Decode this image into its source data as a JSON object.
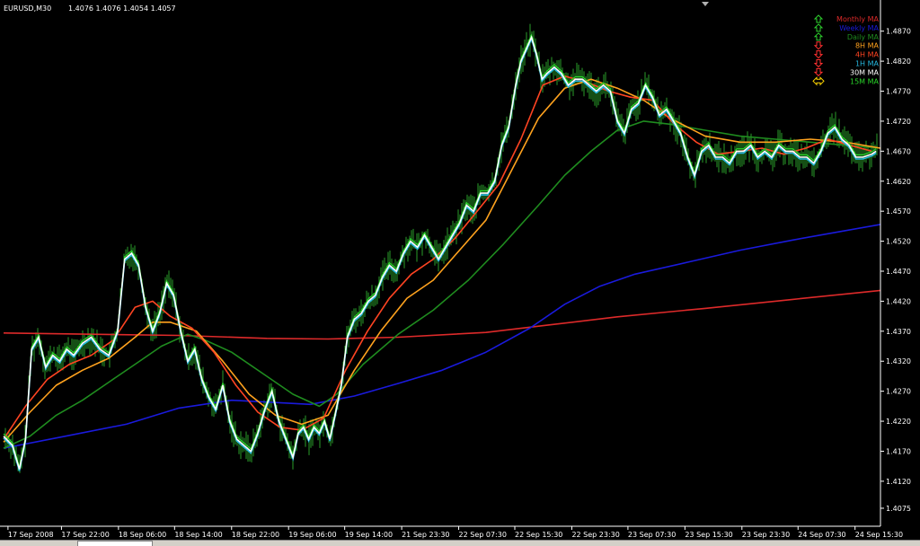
{
  "header": {
    "symbol": "EURUSD,M30",
    "ohlc": "1.4076 1.4076 1.4054 1.4057"
  },
  "colors": {
    "background": "#000000",
    "axis": "#ffffff",
    "bull_bar": "#2a9e2a",
    "price": "#ffffff",
    "monthly": "#dd2a2a",
    "weekly": "#1a1adc",
    "daily": "#1f8c1f",
    "ma8h": "#ffa21e",
    "ma4h": "#ff4422",
    "ma1h": "#26b8e0",
    "ma30m": "#ffffff",
    "ma15m": "#29d629",
    "arrow_up": "#2ed12e",
    "arrow_down": "#ff3030",
    "arrow_side": "#ffd700"
  },
  "legend": [
    {
      "label": "Monthly MA",
      "color": "#dd2a2a",
      "arrow": "up",
      "arrow_color": "#2ed12e"
    },
    {
      "label": "Weekly MA",
      "color": "#1a1adc",
      "arrow": "up",
      "arrow_color": "#2ed12e"
    },
    {
      "label": "Daily MA",
      "color": "#1f8c1f",
      "arrow": "up",
      "arrow_color": "#2ed12e"
    },
    {
      "label": "8H MA",
      "color": "#ffa21e",
      "arrow": "down",
      "arrow_color": "#ff3030"
    },
    {
      "label": "4H MA",
      "color": "#ff4422",
      "arrow": "down",
      "arrow_color": "#ff3030"
    },
    {
      "label": "1H MA",
      "color": "#26b8e0",
      "arrow": "down",
      "arrow_color": "#ff3030"
    },
    {
      "label": "30M MA",
      "color": "#ffffff",
      "arrow": "down",
      "arrow_color": "#ff3030"
    },
    {
      "label": "15M MA",
      "color": "#29d629",
      "arrow": "side",
      "arrow_color": "#ffd700"
    }
  ],
  "chart_data": {
    "type": "line",
    "ylim": [
      1.4045,
      1.4895
    ],
    "xlim": [
      0,
      100
    ],
    "y_ticks": [
      "1.4870",
      "1.4820",
      "1.4770",
      "1.4720",
      "1.4670",
      "1.4620",
      "1.4570",
      "1.4520",
      "1.4470",
      "1.4420",
      "1.4370",
      "1.4320",
      "1.4270",
      "1.4220",
      "1.4170",
      "1.4120",
      "1.4075"
    ],
    "x_ticks": [
      {
        "label": "17 Sep 2008",
        "x": 0.5
      },
      {
        "label": "17 Sep 22:00",
        "x": 6.6
      },
      {
        "label": "18 Sep 06:00",
        "x": 13.1
      },
      {
        "label": "18 Sep 14:00",
        "x": 19.5
      },
      {
        "label": "18 Sep 22:00",
        "x": 26
      },
      {
        "label": "19 Sep 06:00",
        "x": 32.5
      },
      {
        "label": "19 Sep 14:00",
        "x": 38.9
      },
      {
        "label": "21 Sep 23:30",
        "x": 45.4
      },
      {
        "label": "22 Sep 07:30",
        "x": 51.9
      },
      {
        "label": "22 Sep 15:30",
        "x": 58.3
      },
      {
        "label": "22 Sep 23:30",
        "x": 64.8
      },
      {
        "label": "23 Sep 07:30",
        "x": 71.2
      },
      {
        "label": "23 Sep 15:30",
        "x": 77.7
      },
      {
        "label": "23 Sep 23:30",
        "x": 84.2
      },
      {
        "label": "24 Sep 07:30",
        "x": 90.6
      },
      {
        "label": "24 Sep 15:30",
        "x": 97.1
      }
    ],
    "price_x": [
      0,
      1,
      1.8,
      2.5,
      3.2,
      4,
      4.8,
      5.6,
      6.4,
      7.2,
      8,
      9,
      10,
      11,
      12,
      13,
      13.8,
      14.6,
      15.4,
      16.2,
      17,
      17.8,
      18.6,
      19.4,
      20.2,
      21,
      21.8,
      22.6,
      23.4,
      24.2,
      25,
      25.8,
      26.6,
      27.4,
      28.2,
      29,
      29.8,
      30.6,
      31.4,
      32.2,
      33,
      33.6,
      34.2,
      34.8,
      35.4,
      36,
      36.6,
      37.2,
      37.8,
      38.5,
      39.2,
      40,
      40.8,
      41.6,
      42.4,
      43.2,
      44,
      44.8,
      45.6,
      46.4,
      47.2,
      48,
      48.8,
      49.6,
      50.4,
      51.2,
      52,
      52.8,
      53.6,
      54.4,
      55.2,
      56,
      56.8,
      57.6,
      58.4,
      59,
      59.6,
      60.2,
      60.8,
      61.4,
      62,
      62.8,
      63.6,
      64.4,
      65.2,
      66,
      66.8,
      67.6,
      68.4,
      69.2,
      70,
      70.8,
      71.6,
      72.4,
      73.2,
      74,
      74.8,
      75.6,
      76.4,
      77.2,
      78,
      78.8,
      79.6,
      80.4,
      81.2,
      82,
      82.8,
      83.6,
      84.4,
      85.2,
      86,
      86.8,
      87.6,
      88.4,
      89.2,
      90,
      90.8,
      91.6,
      92.4,
      93.2,
      94,
      94.8,
      95.6,
      96.4,
      97.2,
      98,
      99,
      99.5
    ],
    "price_y": [
      1.4195,
      1.418,
      1.414,
      1.419,
      1.434,
      1.436,
      1.431,
      1.433,
      1.432,
      1.434,
      1.433,
      1.435,
      1.436,
      1.434,
      1.433,
      1.437,
      1.449,
      1.45,
      1.448,
      1.441,
      1.437,
      1.44,
      1.445,
      1.443,
      1.437,
      1.432,
      1.434,
      1.429,
      1.426,
      1.424,
      1.428,
      1.422,
      1.419,
      1.418,
      1.417,
      1.42,
      1.424,
      1.427,
      1.422,
      1.419,
      1.416,
      1.42,
      1.421,
      1.419,
      1.421,
      1.42,
      1.422,
      1.419,
      1.423,
      1.428,
      1.436,
      1.439,
      1.44,
      1.442,
      1.443,
      1.446,
      1.448,
      1.447,
      1.45,
      1.452,
      1.451,
      1.453,
      1.451,
      1.449,
      1.451,
      1.453,
      1.455,
      1.458,
      1.457,
      1.46,
      1.46,
      1.462,
      1.468,
      1.471,
      1.478,
      1.482,
      1.484,
      1.486,
      1.483,
      1.479,
      1.48,
      1.481,
      1.48,
      1.478,
      1.479,
      1.479,
      1.478,
      1.477,
      1.478,
      1.477,
      1.472,
      1.47,
      1.474,
      1.475,
      1.478,
      1.476,
      1.473,
      1.474,
      1.472,
      1.47,
      1.466,
      1.463,
      1.467,
      1.468,
      1.466,
      1.466,
      1.465,
      1.467,
      1.467,
      1.468,
      1.466,
      1.467,
      1.466,
      1.468,
      1.467,
      1.467,
      1.466,
      1.466,
      1.465,
      1.467,
      1.47,
      1.471,
      1.469,
      1.468,
      1.466,
      1.466,
      1.4665,
      1.467,
      1.4675
    ],
    "series": [
      {
        "name": "Monthly MA",
        "color": "#dd2a2a",
        "x": [
          0,
          10,
          20,
          30,
          37,
          45,
          55,
          62,
          70,
          80,
          90,
          100
        ],
        "y": [
          1.4367,
          1.4365,
          1.4363,
          1.4358,
          1.4357,
          1.436,
          1.4368,
          1.438,
          1.4394,
          1.4408,
          1.4423,
          1.4438
        ]
      },
      {
        "name": "Weekly MA",
        "color": "#1a1adc",
        "x": [
          0,
          7,
          14,
          20,
          26,
          30,
          35,
          40,
          45,
          50,
          55,
          60,
          64,
          68,
          72,
          78,
          84,
          90,
          95,
          100
        ],
        "y": [
          1.4175,
          1.4195,
          1.4215,
          1.4242,
          1.4255,
          1.4252,
          1.4248,
          1.4262,
          1.4283,
          1.4305,
          1.4335,
          1.4375,
          1.4415,
          1.4445,
          1.4465,
          1.4485,
          1.4505,
          1.4522,
          1.4535,
          1.4548
        ]
      },
      {
        "name": "Daily MA",
        "color": "#1f8c1f",
        "x": [
          0,
          3,
          6,
          9,
          12,
          15,
          18,
          21,
          23,
          26,
          30,
          33,
          36,
          38,
          41,
          45,
          49,
          53,
          57,
          61,
          64,
          67,
          70,
          73,
          76,
          80,
          84,
          88,
          92,
          96,
          100
        ],
        "y": [
          1.4175,
          1.4195,
          1.423,
          1.4255,
          1.4285,
          1.4315,
          1.4345,
          1.4365,
          1.4355,
          1.4335,
          1.4295,
          1.4265,
          1.4245,
          1.4265,
          1.4315,
          1.4365,
          1.4405,
          1.4455,
          1.4515,
          1.458,
          1.463,
          1.467,
          1.4705,
          1.472,
          1.4715,
          1.4705,
          1.4695,
          1.469,
          1.4685,
          1.468,
          1.4675
        ]
      },
      {
        "name": "8H MA",
        "color": "#ffa21e",
        "x": [
          0,
          3,
          6,
          9,
          12,
          15,
          17,
          19,
          22,
          25,
          28,
          31,
          34,
          37,
          40,
          43,
          46,
          49,
          52,
          55,
          58,
          61,
          64,
          67,
          70,
          73,
          76,
          80,
          84,
          88,
          92,
          96,
          100
        ],
        "y": [
          1.4185,
          1.4235,
          1.428,
          1.4305,
          1.4325,
          1.436,
          1.4385,
          1.4385,
          1.437,
          1.432,
          1.4265,
          1.423,
          1.4215,
          1.423,
          1.4305,
          1.437,
          1.4425,
          1.4455,
          1.4505,
          1.4555,
          1.464,
          1.4725,
          1.4775,
          1.479,
          1.4775,
          1.4755,
          1.4725,
          1.4695,
          1.4685,
          1.4685,
          1.469,
          1.4685,
          1.4675
        ]
      },
      {
        "name": "4H MA",
        "color": "#ff4422",
        "x": [
          0,
          2.5,
          5,
          7.5,
          10,
          12.5,
          15,
          17,
          19,
          21.5,
          24,
          26.5,
          29,
          31.5,
          34,
          36.5,
          39,
          41.5,
          44,
          46.5,
          49,
          51.5,
          54,
          56.5,
          59,
          61.5,
          64,
          66.5,
          69,
          71.5,
          74,
          76.5,
          79,
          81.5,
          84,
          86.5,
          89,
          91.5,
          94,
          96.5,
          99
        ],
        "y": [
          1.419,
          1.4245,
          1.429,
          1.4315,
          1.433,
          1.4355,
          1.441,
          1.442,
          1.4395,
          1.4375,
          1.4335,
          1.428,
          1.4235,
          1.421,
          1.4205,
          1.4225,
          1.4305,
          1.437,
          1.4425,
          1.4465,
          1.449,
          1.4525,
          1.457,
          1.4615,
          1.469,
          1.478,
          1.4795,
          1.4785,
          1.477,
          1.476,
          1.4755,
          1.4715,
          1.4685,
          1.4665,
          1.467,
          1.4675,
          1.4665,
          1.4675,
          1.469,
          1.468,
          1.467
        ]
      }
    ]
  }
}
